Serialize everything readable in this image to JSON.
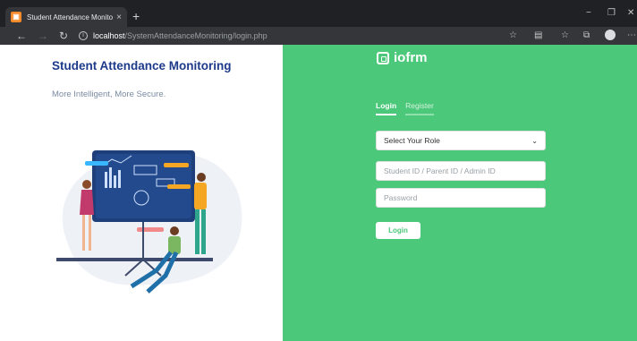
{
  "browser": {
    "tab_title": "Student Attendance Monitoring",
    "tab_favicon": "bookmark-icon",
    "tab_close": "×",
    "new_tab": "+",
    "url_host": "localhost",
    "url_path": "/SystemAttendanceMonitoring/login.php",
    "window_controls": [
      "−",
      "❐",
      "✕"
    ],
    "toolbar_icons": [
      "star-icon",
      "reader-icon",
      "favorites-icon",
      "collections-icon",
      "profile-icon",
      "more-icon"
    ]
  },
  "left": {
    "heading": "Student Attendance Monitoring",
    "subheading": "More Intelligent, More Secure."
  },
  "right": {
    "brand_name": "iofrm",
    "tabs": [
      {
        "label": "Login",
        "active": true
      },
      {
        "label": "Register",
        "active": false
      }
    ],
    "role_select": {
      "selected": "Select Your Role"
    },
    "id_field": {
      "placeholder": "Student ID / Parent ID / Admin ID"
    },
    "password_field": {
      "placeholder": "Password"
    },
    "login_button": "Login"
  },
  "colors": {
    "accent_green": "#4bc879",
    "heading_blue": "#1e3a8a",
    "chrome_dark": "#202124"
  }
}
